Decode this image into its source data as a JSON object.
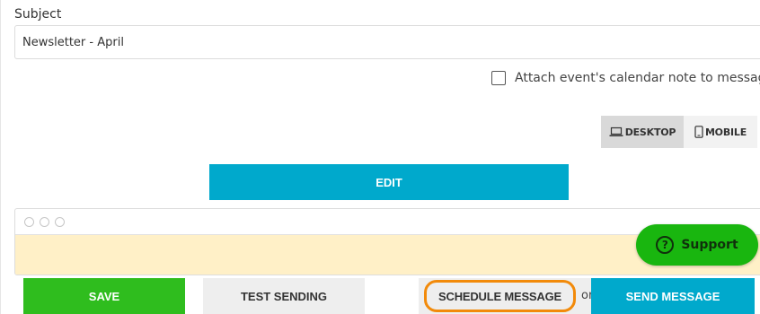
{
  "form": {
    "subject_label": "Subject",
    "subject_value": "Newsletter - April",
    "attach_label": "Attach event's calendar note to message",
    "attach_checked": false
  },
  "view_toggle": {
    "desktop_label": "DESKTOP",
    "mobile_label": "MOBILE",
    "active": "DESKTOP"
  },
  "editor": {
    "edit_label": "EDIT"
  },
  "support": {
    "label": "Support",
    "icon": "question-icon"
  },
  "actions": {
    "save_label": "SAVE",
    "test_label": "TEST SENDING",
    "schedule_label": "SCHEDULE MESSAGE",
    "or_label": "or",
    "send_label": "SEND MESSAGE"
  },
  "colors": {
    "accent_blue": "#00a9cc",
    "save_green": "#2fbd1e",
    "support_green": "#19b60f",
    "highlight_orange": "#f28a0a",
    "preview_yellow": "#fff0c7"
  }
}
